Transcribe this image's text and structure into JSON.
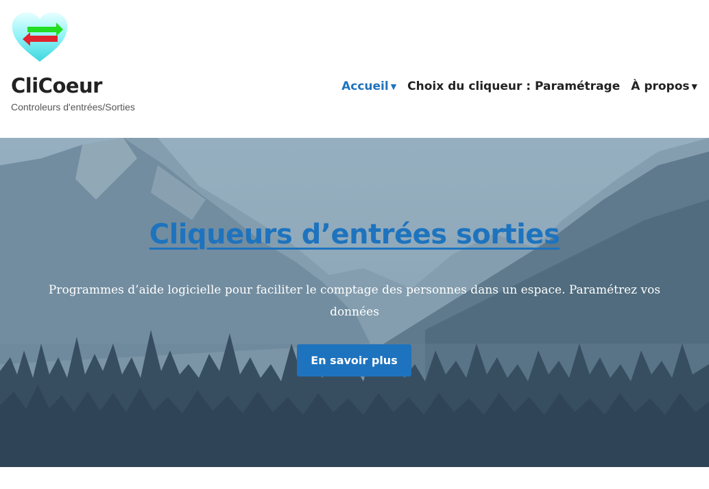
{
  "site": {
    "title": "CliCoeur",
    "description": "Controleurs d'entrées/Sorties",
    "logo_icon": "heart-arrows-icon"
  },
  "nav": {
    "items": [
      {
        "label": "Accueil",
        "has_dropdown": true,
        "active": true
      },
      {
        "label": "Choix du cliqueur : Paramétrage",
        "has_dropdown": false,
        "active": false
      },
      {
        "label": "À propos",
        "has_dropdown": true,
        "active": false
      }
    ]
  },
  "hero": {
    "title": "Cliqueurs d’entrées sorties",
    "text": "Programmes d’aide logicielle pour faciliter le comptage des personnes dans un espace. Paramétrez vos données",
    "button_label": "En savoir plus"
  },
  "colors": {
    "accent": "#1e73be",
    "hero_overlay": "#6f8ea3"
  }
}
